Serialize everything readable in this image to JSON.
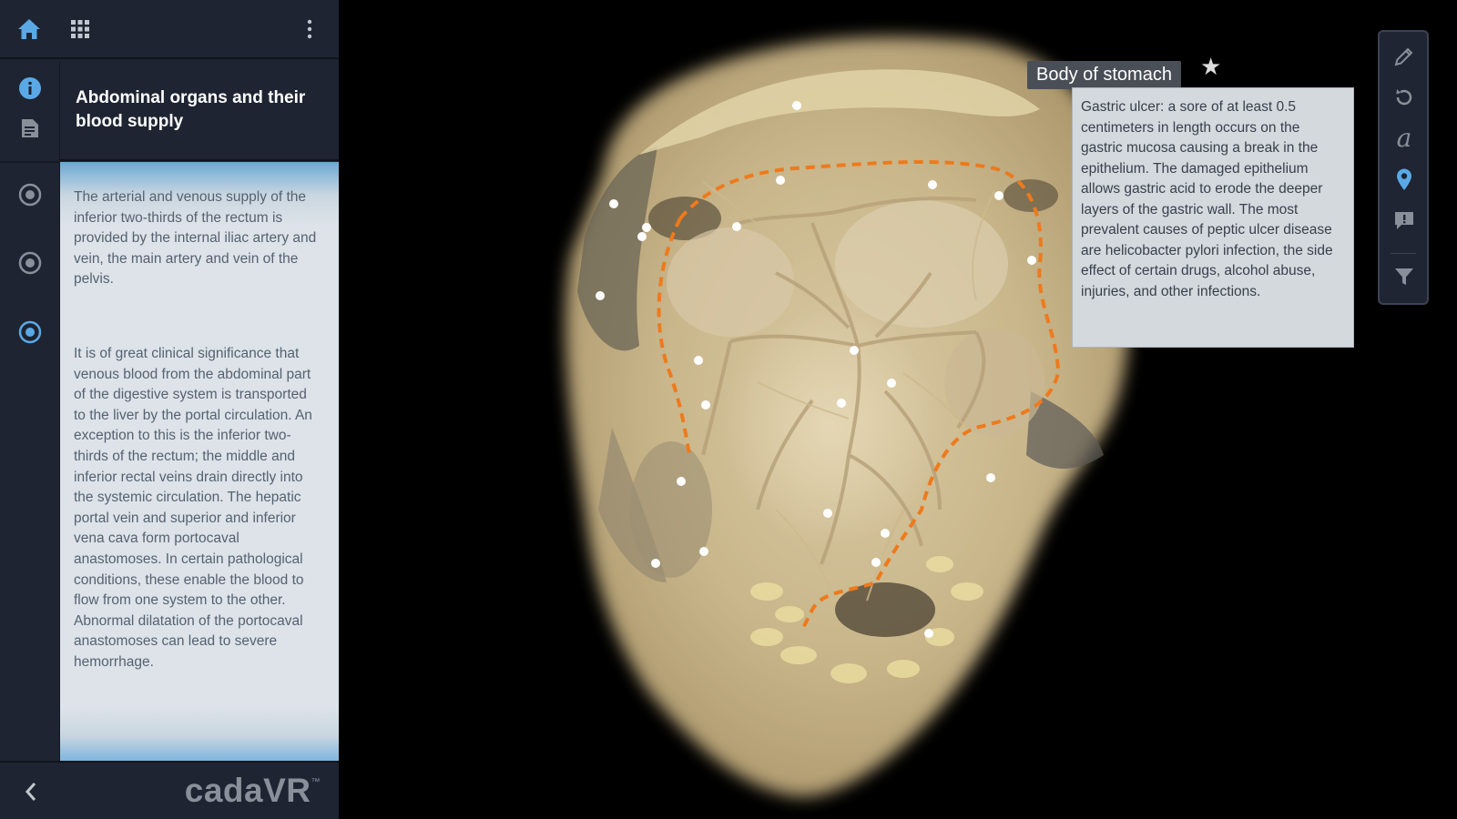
{
  "app": {
    "logo": "cadaVR"
  },
  "topbar": {
    "home_icon": "home-icon",
    "grid_icon": "grid-icon",
    "menu_icon": "more-vertical-icon"
  },
  "rail": {
    "items": [
      "info-icon",
      "notes-icon",
      "target-icon",
      "target-icon",
      "target-icon"
    ]
  },
  "lesson": {
    "title": "Abdominal organs and their blood supply",
    "paragraphs": [
      "The arterial and venous supply of the inferior two-thirds of the rectum is provided by the internal iliac artery and vein, the main artery and vein of the pelvis.",
      "It is of great clinical significance that venous blood from the abdominal part of the digestive system is transported to the liver by the portal circulation. An exception to this is the inferior two-thirds of the rectum; the middle and inferior rectal veins drain directly into the systemic circulation. The hepatic portal vein and superior and inferior vena cava form portocaval anastomoses. In certain pathological conditions, these enable the blood to flow from one system to the other. Abnormal dilatation of the portocaval anastomoses can lead to severe hemorrhage."
    ]
  },
  "viewer": {
    "label": "Body of stomach",
    "star_icon": "star-icon",
    "info": "Gastric ulcer: a sore of at least 0.5 centimeters in length occurs on the gastric mucosa causing a break in the epithelium. The damaged epithelium allows gastric acid to erode the deeper layers of the gastric wall. The most prevalent causes of peptic ulcer disease are helicobacter pylori infection, the side effect of certain drugs, alcohol abuse, injuries, and other infections."
  },
  "toolbar": {
    "tools": [
      "pencil-icon",
      "reset-icon",
      "annotation-icon",
      "pin-icon",
      "comment-icon",
      "filter-icon"
    ]
  },
  "colors": {
    "panel": "#1e2431",
    "accent": "#5aa9e6",
    "highlight_outline": "#ee7a1c",
    "content_bg": "#dde3e9",
    "tooltip_bg": "#d4d9de"
  }
}
